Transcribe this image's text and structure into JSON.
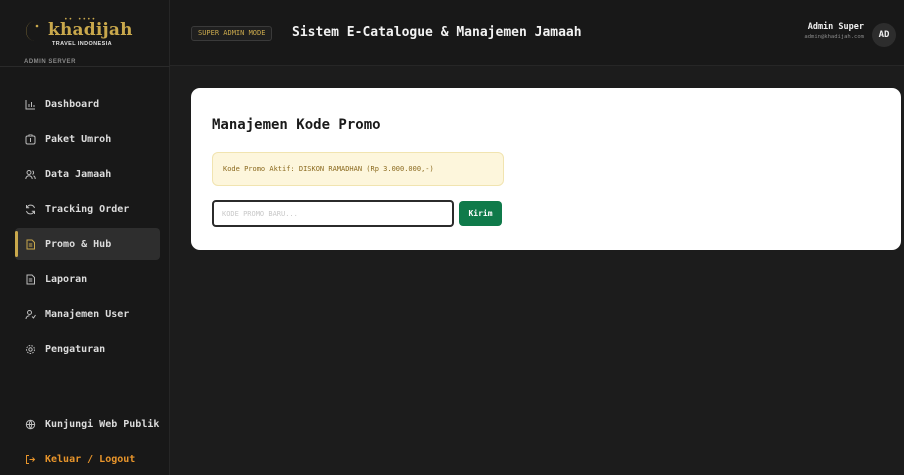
{
  "brand": {
    "dots": "•• ••••",
    "name": "khadijah",
    "subtitle": "TRAVEL INDONESIA",
    "server_label": "ADMIN SERVER"
  },
  "topbar": {
    "mode_badge": "SUPER ADMIN MODE",
    "title": "Sistem E-Catalogue & Manajemen Jamaah",
    "user_name": "Admin Super",
    "user_email": "admin@khadijah.com",
    "avatar_initials": "AD"
  },
  "sidebar": {
    "items": [
      {
        "label": "Dashboard",
        "icon": "chart-icon"
      },
      {
        "label": "Paket Umroh",
        "icon": "package-icon"
      },
      {
        "label": "Data Jamaah",
        "icon": "users-icon"
      },
      {
        "label": "Tracking Order",
        "icon": "refresh-icon"
      },
      {
        "label": "Promo & Hub",
        "icon": "document-icon",
        "active": true
      },
      {
        "label": "Laporan",
        "icon": "report-icon"
      },
      {
        "label": "Manajemen User",
        "icon": "user-manage-icon"
      },
      {
        "label": "Pengaturan",
        "icon": "gear-icon"
      }
    ],
    "bottom": [
      {
        "label": "Kunjungi Web Publik",
        "icon": "globe-icon"
      },
      {
        "label": "Keluar / Logout",
        "icon": "logout-icon"
      }
    ]
  },
  "main": {
    "title": "Manajemen Kode Promo",
    "active_promo": "Kode Promo Aktif: DISKON RAMADHAN (Rp 3.000.000,-)",
    "input_placeholder": "KODE PROMO BARU...",
    "send_label": "Kirim"
  },
  "colors": {
    "accent_gold": "#c9a84c",
    "send_green": "#0f7a4a",
    "logout_orange": "#e8952b",
    "background": "#1c1c1c"
  }
}
